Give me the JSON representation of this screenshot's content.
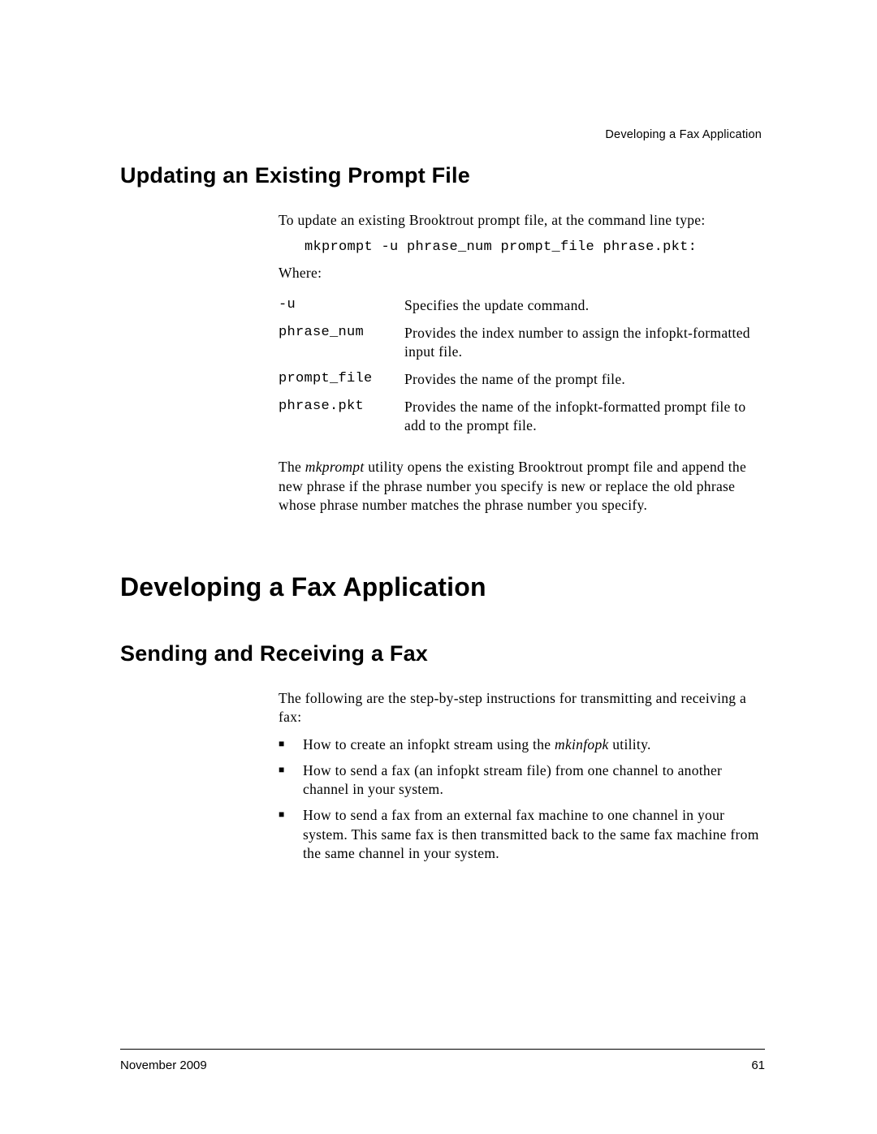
{
  "running_head": "Developing a Fax Application",
  "section1": {
    "title": "Updating an Existing Prompt File",
    "intro": "To update an existing Brooktrout prompt file, at the command line type:",
    "command": "mkprompt -u phrase_num prompt_file phrase.pkt:",
    "where_label": "Where:",
    "params": [
      {
        "key": "-u",
        "desc": "Specifies the update command."
      },
      {
        "key": "phrase_num",
        "desc": "Provides the index number to assign the infopkt-formatted input file."
      },
      {
        "key": "prompt_file",
        "desc": "Provides the name of the prompt file."
      },
      {
        "key": "phrase.pkt",
        "desc": "Provides the name of the infopkt-formatted prompt file to add to the prompt file."
      }
    ],
    "outro_pre": "The ",
    "outro_em": "mkprompt",
    "outro_post": " utility opens the existing Brooktrout prompt file and append the new phrase if the phrase number you specify is new or replace the old phrase whose phrase number matches the phrase number you specify."
  },
  "chapter": {
    "title": "Developing a Fax Application"
  },
  "section2": {
    "title": "Sending and Receiving a Fax",
    "intro": "The following are the step-by-step instructions for transmitting and receiving a fax:",
    "bullets": {
      "b1_pre": "How to create an infopkt stream using the ",
      "b1_em": "mkinfopk",
      "b1_post": " utility.",
      "b2": "How to send a fax (an infopkt stream file) from one channel to another channel in your system.",
      "b3": "How to send a fax from an external fax machine to one channel in your system. This same fax is then transmitted back to the same fax machine from the same channel in your system."
    }
  },
  "footer": {
    "date": "November 2009",
    "page": "61"
  }
}
